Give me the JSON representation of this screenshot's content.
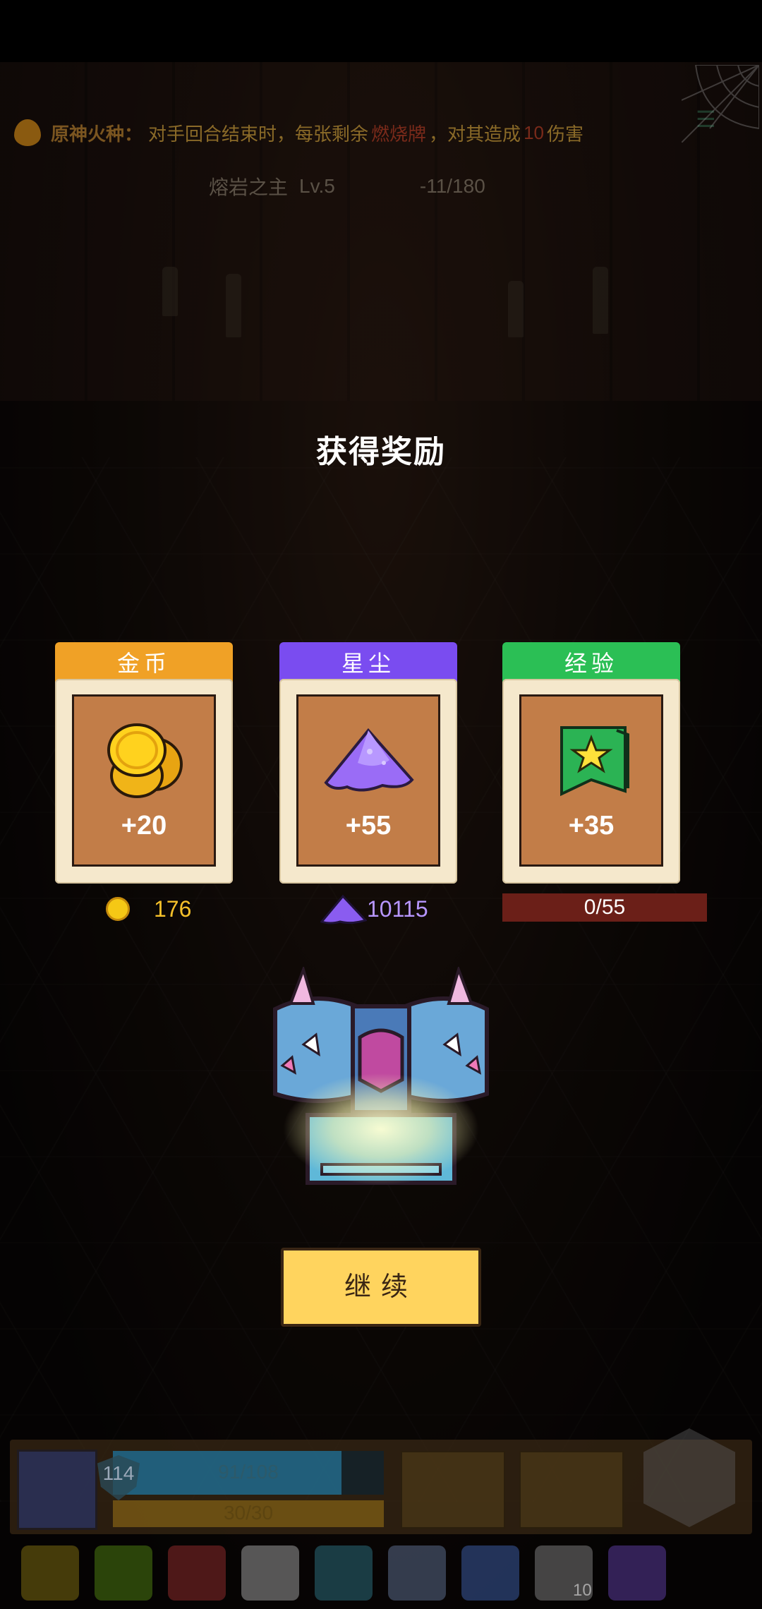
{
  "buff": {
    "name": "原神火种：",
    "desc_1": "对手回合结束时，每张剩余",
    "card_type": "燃烧牌",
    "desc_2": "，对其造成",
    "damage": "10",
    "desc_3": "伤害"
  },
  "boss": {
    "name": "熔岩之主",
    "level": "Lv.5",
    "hp": "-11/180"
  },
  "dialog": {
    "title": "获得奖励",
    "cards": [
      {
        "label": "金币",
        "amount": "+20",
        "icon": "gold-coins-icon",
        "color": "#f0a126"
      },
      {
        "label": "星尘",
        "amount": "+55",
        "icon": "stardust-pile-icon",
        "color": "#7a4cf0"
      },
      {
        "label": "经验",
        "amount": "+35",
        "icon": "star-banner-icon",
        "color": "#2bbf55"
      }
    ],
    "totals": {
      "gold": "176",
      "stardust": "10115",
      "exp": "0/55"
    },
    "continue_label": "继续"
  },
  "player": {
    "shield": "114",
    "hp_text": "91/108",
    "hp_fraction": 0.843,
    "energy_text": "30/30",
    "relic_count": "10"
  }
}
